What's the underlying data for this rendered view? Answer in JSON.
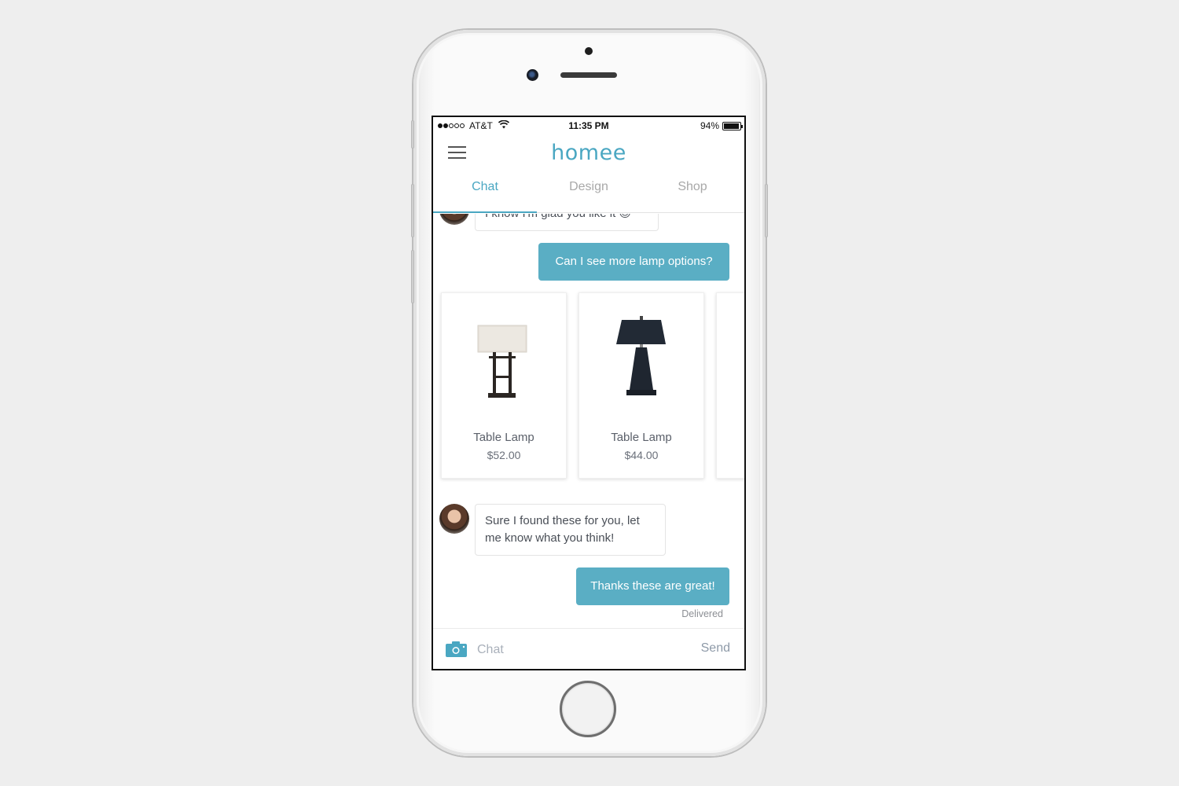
{
  "status_bar": {
    "signal_strength": "2 of 5",
    "carrier": "AT&T",
    "wifi_icon": "wifi-icon",
    "time": "11:35 PM",
    "battery_percent_label": "94%",
    "battery_level": 0.94
  },
  "header": {
    "menu_icon": "hamburger-menu-icon",
    "logo": "homee",
    "accent_color": "#4aa7c2"
  },
  "tabs": [
    {
      "label": "Chat",
      "active": true
    },
    {
      "label": "Design",
      "active": false
    },
    {
      "label": "Shop",
      "active": false
    }
  ],
  "messages": [
    {
      "from": "agent",
      "text": "I know I'm glad you like it 😊"
    },
    {
      "from": "user",
      "text": "Can I see more lamp options?"
    },
    {
      "from": "agent",
      "type": "product-carousel"
    },
    {
      "from": "agent",
      "text": "Sure I found these for you, let me know what you think!"
    },
    {
      "from": "user",
      "text": "Thanks these are great!",
      "status": "Delivered"
    }
  ],
  "products": [
    {
      "name": "Table Lamp",
      "price": "$52.00",
      "image": "rectangular-shade-lamp"
    },
    {
      "name": "Table Lamp",
      "price": "$44.00",
      "image": "black-pyramid-lamp"
    },
    {
      "name": "",
      "price": "",
      "image": ""
    }
  ],
  "composer": {
    "camera_icon": "camera-icon",
    "placeholder": "Chat",
    "value": "",
    "send_label": "Send"
  }
}
